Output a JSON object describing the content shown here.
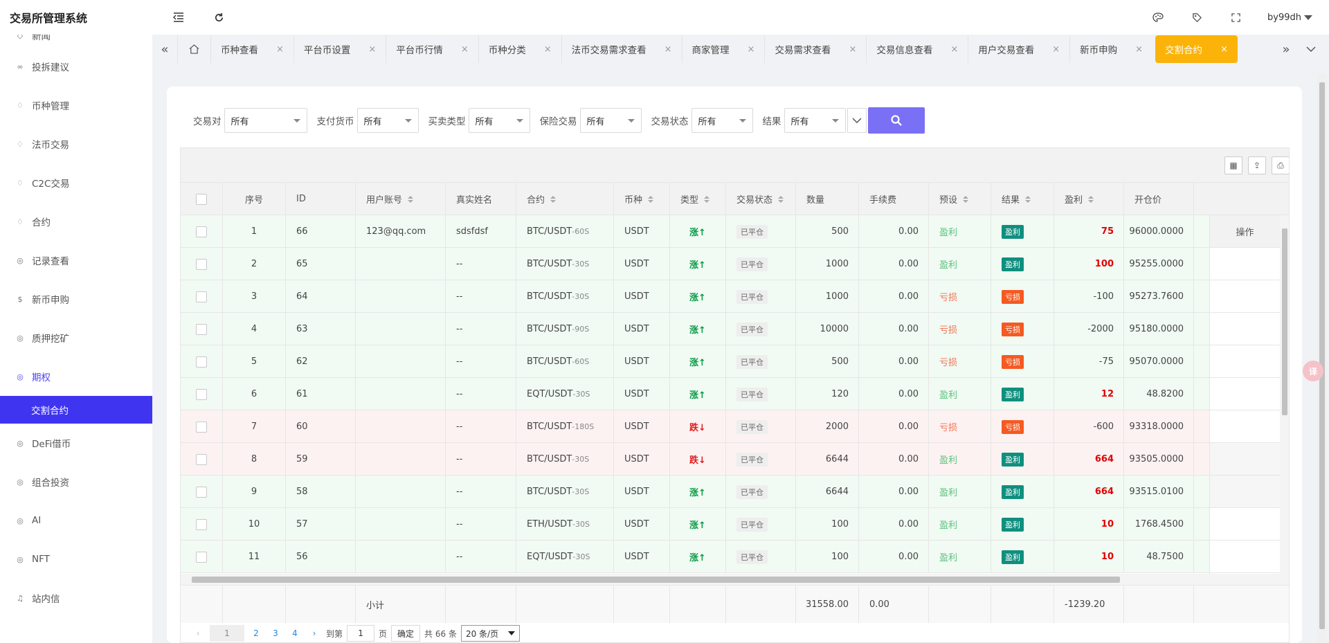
{
  "app": {
    "title": "交易所管理系统",
    "user": "by99dh"
  },
  "sidebar": {
    "items": [
      {
        "label": "新闻",
        "icon": "tag-icon"
      },
      {
        "label": "投拆建议",
        "icon": "link-icon"
      },
      {
        "label": "币种管理",
        "icon": "diamond-icon"
      },
      {
        "label": "法币交易",
        "icon": "diamond-icon"
      },
      {
        "label": "C2C交易",
        "icon": "diamond-icon"
      },
      {
        "label": "合约",
        "icon": "diamond-icon"
      },
      {
        "label": "记录查看",
        "icon": "circle-icon"
      },
      {
        "label": "新币申购",
        "icon": "dollar-icon"
      },
      {
        "label": "质押挖矿",
        "icon": "circle-icon"
      },
      {
        "label": "期权",
        "icon": "circle-icon"
      },
      {
        "label": "DeFi借币",
        "icon": "circle-icon"
      },
      {
        "label": "组合投资",
        "icon": "circle-icon"
      },
      {
        "label": "AI",
        "icon": "circle-icon"
      },
      {
        "label": "NFT",
        "icon": "circle-icon"
      },
      {
        "label": "站内信",
        "icon": "bell-icon"
      }
    ],
    "active_sub": "交割合约"
  },
  "tabs": [
    "币种查看",
    "平台币设置",
    "平台币行情",
    "币种分类",
    "法币交易需求查看",
    "商家管理",
    "交易需求查看",
    "交易信息查看",
    "用户交易查看",
    "新币申购",
    "交割合约"
  ],
  "tab_close": "×",
  "filters": [
    {
      "label": "交易对",
      "value": "所有"
    },
    {
      "label": "支付货币",
      "value": "所有"
    },
    {
      "label": "买卖类型",
      "value": "所有"
    },
    {
      "label": "保险交易",
      "value": "所有"
    },
    {
      "label": "交易状态",
      "value": "所有"
    },
    {
      "label": "结果",
      "value": "所有"
    }
  ],
  "table": {
    "headers": [
      "序号",
      "ID",
      "用户账号",
      "真实姓名",
      "合约",
      "币种",
      "类型",
      "交易状态",
      "数量",
      "手续费",
      "预设",
      "结果",
      "盈利",
      "开仓价"
    ],
    "op_header": "操作",
    "rows": [
      {
        "no": "1",
        "id": "66",
        "account": "123@qq.com",
        "name": "sdsfdsf",
        "pair": "BTC/USDT",
        "period": "-60S",
        "coin": "USDT",
        "dir": "涨↑",
        "status": "已平仓",
        "qty": "500",
        "fee": "0.00",
        "preset": "盈利",
        "result": "盈利",
        "pl": "75",
        "open": "96000.0000"
      },
      {
        "no": "2",
        "id": "65",
        "account": "",
        "name": "--",
        "pair": "BTC/USDT",
        "period": "-30S",
        "coin": "USDT",
        "dir": "涨↑",
        "status": "已平仓",
        "qty": "1000",
        "fee": "0.00",
        "preset": "盈利",
        "result": "盈利",
        "pl": "100",
        "open": "95255.0000"
      },
      {
        "no": "3",
        "id": "64",
        "account": "",
        "name": "--",
        "pair": "BTC/USDT",
        "period": "-30S",
        "coin": "USDT",
        "dir": "涨↑",
        "status": "已平仓",
        "qty": "1000",
        "fee": "0.00",
        "preset": "亏损",
        "result": "亏损",
        "pl": "-100",
        "open": "95273.7600"
      },
      {
        "no": "4",
        "id": "63",
        "account": "",
        "name": "--",
        "pair": "BTC/USDT",
        "period": "-90S",
        "coin": "USDT",
        "dir": "涨↑",
        "status": "已平仓",
        "qty": "10000",
        "fee": "0.00",
        "preset": "亏损",
        "result": "亏损",
        "pl": "-2000",
        "open": "95180.0000"
      },
      {
        "no": "5",
        "id": "62",
        "account": "",
        "name": "--",
        "pair": "BTC/USDT",
        "period": "-60S",
        "coin": "USDT",
        "dir": "涨↑",
        "status": "已平仓",
        "qty": "500",
        "fee": "0.00",
        "preset": "亏损",
        "result": "亏损",
        "pl": "-75",
        "open": "95070.0000"
      },
      {
        "no": "6",
        "id": "61",
        "account": "",
        "name": "--",
        "pair": "EQT/USDT",
        "period": "-30S",
        "coin": "USDT",
        "dir": "涨↑",
        "status": "已平仓",
        "qty": "120",
        "fee": "0.00",
        "preset": "盈利",
        "result": "盈利",
        "pl": "12",
        "open": "48.8200"
      },
      {
        "no": "7",
        "id": "60",
        "account": "",
        "name": "--",
        "pair": "BTC/USDT",
        "period": "-180S",
        "coin": "USDT",
        "dir": "跌↓",
        "status": "已平仓",
        "qty": "2000",
        "fee": "0.00",
        "preset": "亏损",
        "result": "亏损",
        "pl": "-600",
        "open": "93318.0000"
      },
      {
        "no": "8",
        "id": "59",
        "account": "",
        "name": "--",
        "pair": "BTC/USDT",
        "period": "-30S",
        "coin": "USDT",
        "dir": "跌↓",
        "status": "已平仓",
        "qty": "6644",
        "fee": "0.00",
        "preset": "盈利",
        "result": "盈利",
        "pl": "664",
        "open": "93505.0000"
      },
      {
        "no": "9",
        "id": "58",
        "account": "",
        "name": "--",
        "pair": "BTC/USDT",
        "period": "-30S",
        "coin": "USDT",
        "dir": "涨↑",
        "status": "已平仓",
        "qty": "6644",
        "fee": "0.00",
        "preset": "盈利",
        "result": "盈利",
        "pl": "664",
        "open": "93515.0100"
      },
      {
        "no": "10",
        "id": "57",
        "account": "",
        "name": "--",
        "pair": "ETH/USDT",
        "period": "-30S",
        "coin": "USDT",
        "dir": "涨↑",
        "status": "已平仓",
        "qty": "100",
        "fee": "0.00",
        "preset": "盈利",
        "result": "盈利",
        "pl": "10",
        "open": "1768.4500"
      },
      {
        "no": "11",
        "id": "56",
        "account": "",
        "name": "--",
        "pair": "EQT/USDT",
        "period": "-30S",
        "coin": "USDT",
        "dir": "涨↑",
        "status": "已平仓",
        "qty": "100",
        "fee": "0.00",
        "preset": "盈利",
        "result": "盈利",
        "pl": "10",
        "open": "48.7500"
      }
    ],
    "totals": {
      "label": "小计",
      "qty": "31558.00",
      "fee": "0.00",
      "pl": "-1239.20"
    }
  },
  "pager": {
    "current": "1",
    "pages": [
      "2",
      "3",
      "4"
    ],
    "goto_label": "到第",
    "goto_value": "1",
    "page_unit": "页",
    "confirm": "确定",
    "total": "共 66 条",
    "per_page": "20 条/页"
  },
  "colors": {
    "accent": "#3f35f0",
    "active_tab": "#fbb30a",
    "search": "#7a70f5",
    "win": "#0f8f7e",
    "loss": "#f55a22"
  }
}
